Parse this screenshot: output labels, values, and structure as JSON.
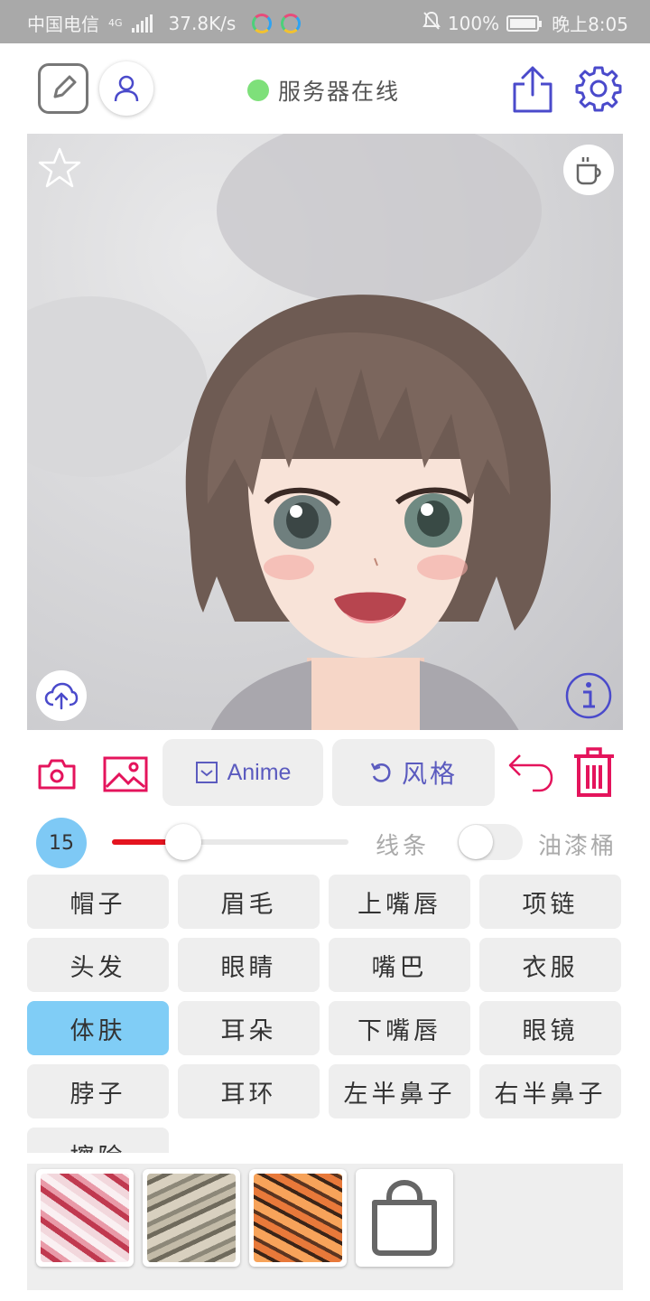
{
  "status_bar": {
    "carrier": "中国电信",
    "network": "4G",
    "speed": "37.8K/s",
    "battery": "100%",
    "time": "晚上8:05"
  },
  "header": {
    "server_status": "服务器在线",
    "server_status_color": "#7ee07a"
  },
  "canvas": {
    "top_left_icon": "star-icon",
    "top_right_icon": "coffee-icon",
    "bottom_left_icon": "cloud-upload-icon",
    "bottom_right_icon": "info-icon"
  },
  "actions": {
    "anime_label": "Anime",
    "style_label": "风格",
    "accent_color": "#e4145c",
    "button_text_color": "#5b5bbf"
  },
  "brush": {
    "size": "15",
    "size_fraction": 0.3,
    "line_label": "线条",
    "bucket_label": "油漆桶",
    "bucket_enabled": false
  },
  "parts": {
    "items": [
      "帽子",
      "眉毛",
      "上嘴唇",
      "项链",
      "头发",
      "眼睛",
      "嘴巴",
      "衣服",
      "体肤",
      "耳朵",
      "下嘴唇",
      "眼镜",
      "脖子",
      "耳环",
      "左半鼻子",
      "右半鼻子",
      "擦除"
    ],
    "selected": "体肤",
    "selected_color": "#80cdf6"
  },
  "textures": {
    "items": [
      "red-texture",
      "camo-texture",
      "tiger-texture"
    ],
    "shop_icon": "shopping-bag-icon"
  }
}
